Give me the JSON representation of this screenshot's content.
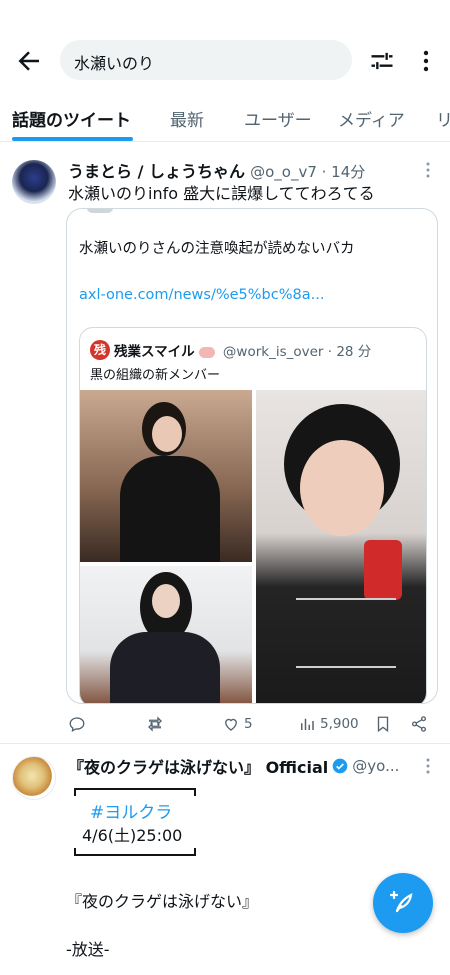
{
  "search": {
    "query": "水瀬いのり"
  },
  "tabs": [
    {
      "label": "話題のツイート",
      "active": true
    },
    {
      "label": "最新"
    },
    {
      "label": "ユーザー"
    },
    {
      "label": "メディア"
    },
    {
      "label": "リ"
    }
  ],
  "tweet1": {
    "name": "うまとら / しょうちゃん",
    "meta": "@o_o_v7 · 14分",
    "text": "水瀬いのりinfo 盛大に誤爆しててわろてる",
    "card": {
      "text": "水瀬いのりさんの注意喚起が読めないバカ",
      "link": "axl-one.com/news/%e5%bc%8a...",
      "quote": {
        "icon_char": "残",
        "name": "残業スマイル",
        "meta": "@work_is_over · 28 分",
        "text": "黒の組織の新メンバー"
      }
    },
    "actions": {
      "likes": "5",
      "views": "5,900"
    }
  },
  "tweet2": {
    "name": "『夜のクラゲは泳げない』 Official",
    "handle": "@yo...",
    "hashtag": "#ヨルクラ",
    "airtime": "4/6(土)25:00",
    "title": "『夜のクラゲは泳げない』",
    "broadcast": "-放送-"
  },
  "colors": {
    "accent": "#1d9bf0",
    "text": "#0f1419",
    "muted": "#536471"
  }
}
